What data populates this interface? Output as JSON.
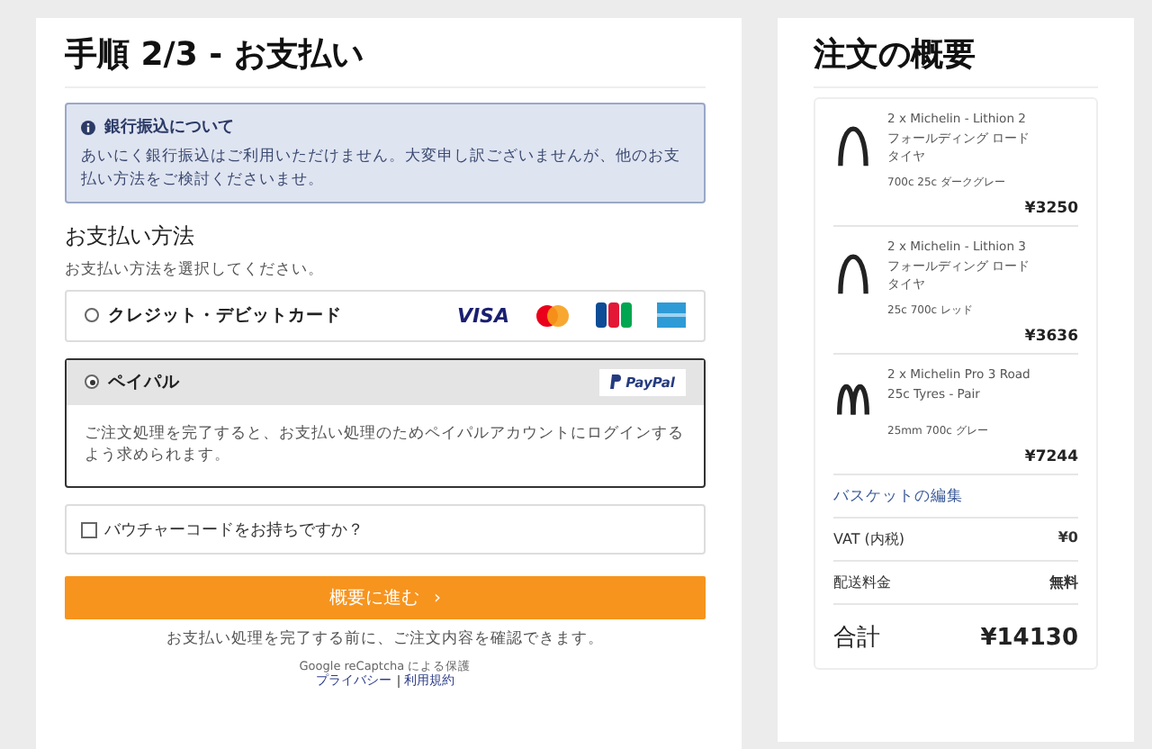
{
  "checkout": {
    "title": "手順 2/3 - お支払い",
    "notice": {
      "title": "銀行振込について",
      "text": "あいにく銀行振込はご利用いただけません。大変申し訳ございませんが、他のお支払い方法をご検討くださいませ。"
    },
    "payment_heading": "お支払い方法",
    "payment_hint": "お支払い方法を選択してください。",
    "payment_methods": [
      {
        "kind": "card",
        "label": "クレジット・デビットカード",
        "selected": false,
        "brand_text": "VISA"
      },
      {
        "kind": "paypal",
        "label": "ペイパル",
        "selected": true,
        "brand_text": "PayPal",
        "description": "ご注文処理を完了すると、お支払い処理のためペイパルアカウントにログインするよう求められます。"
      }
    ],
    "voucher": {
      "label": "バウチャーコードをお持ちですか？",
      "checked": false
    },
    "continue_button": "概要に進む",
    "continue_arrow": "›",
    "review_note": "お支払い処理を完了する前に、ご注文内容を確認できます。",
    "recaptcha": "Google reCaptcha による保護",
    "links": [
      "プライバシー",
      "利用規約"
    ]
  },
  "summary": {
    "title": "注文の概要",
    "items": [
      {
        "name": "2 x Michelin - Lithion 2 フォールディング ロードタイヤ",
        "variant": "700c 25c ダークグレー",
        "price": "¥3250",
        "kind": "single"
      },
      {
        "name": "2 x Michelin - Lithion 3 フォールディング ロードタイヤ",
        "variant": "25c 700c レッド",
        "price": "¥3636",
        "kind": "single"
      },
      {
        "name": "2 x Michelin Pro 3 Road 25c Tyres - Pair",
        "variant": "25mm 700c グレー",
        "price": "¥7244",
        "kind": "pair"
      }
    ],
    "edit_link": "バスケットの編集",
    "rows": [
      {
        "label": "VAT (内税)",
        "value": "¥0"
      },
      {
        "label": "配送料金",
        "value": "無料"
      }
    ],
    "total": {
      "label": "合計",
      "value": "¥14130"
    }
  }
}
